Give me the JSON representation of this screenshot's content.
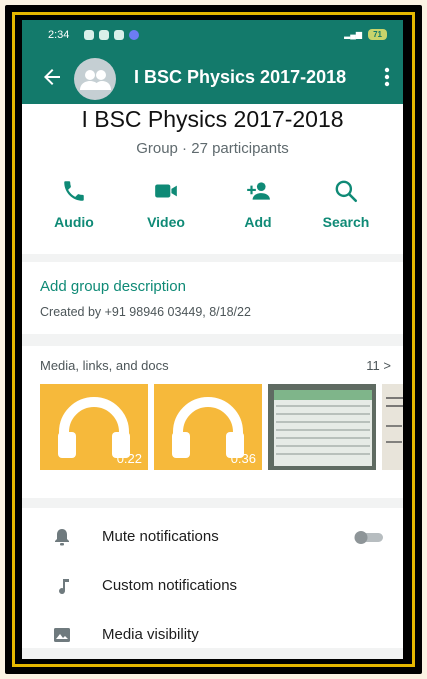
{
  "status": {
    "time": "2:34",
    "battery": "71"
  },
  "appbar": {
    "title": "I BSC Physics 2017-2018"
  },
  "group": {
    "name": "I BSC Physics 2017-2018",
    "subtitle": "Group · 27 participants"
  },
  "actions": [
    {
      "label": "Audio",
      "icon": "phone-icon"
    },
    {
      "label": "Video",
      "icon": "video-camera-icon"
    },
    {
      "label": "Add",
      "icon": "add-person-icon"
    },
    {
      "label": "Search",
      "icon": "search-icon"
    }
  ],
  "description": {
    "add_label": "Add group description",
    "created": "Created by +91 98946 03449, 8/18/22"
  },
  "media": {
    "title": "Media, links, and docs",
    "count": "11 >",
    "items": [
      {
        "type": "audio",
        "duration": "0:22"
      },
      {
        "type": "audio",
        "duration": "0:36"
      },
      {
        "type": "image"
      },
      {
        "type": "image"
      }
    ]
  },
  "settings": [
    {
      "label": "Mute notifications",
      "icon": "bell-icon",
      "toggle": false
    },
    {
      "label": "Custom notifications",
      "icon": "music-note-icon"
    },
    {
      "label": "Media visibility",
      "icon": "image-icon"
    }
  ],
  "colors": {
    "primary": "#137a6b",
    "accent": "#0f8a76",
    "audio_thumb": "#f6b93b",
    "frame": "#e6b800"
  }
}
